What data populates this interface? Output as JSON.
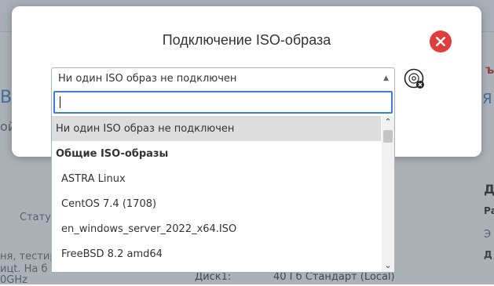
{
  "background": {
    "status_label": "Стату",
    "text_left_1": "ня, тестир",
    "text_left_2": "ицt. На б",
    "text_left_3": "0GHz",
    "text_left_4": "ой",
    "letter_b": "В",
    "letter_right_red": "ъ",
    "letter_right_blue": "Я",
    "right_d": "Д",
    "right_ra": "Ра",
    "right_e": "Э",
    "right_d2": "Д",
    "disk_label": "Диск1:",
    "disk_value": "40 Гб Стандарт (Local)"
  },
  "modal": {
    "title": "Подключение ISO-образа",
    "close_icon": "close-icon",
    "disc_icon": "disc-eject-icon"
  },
  "select": {
    "value": "Ни один ISO образ не подключен",
    "search_value": ""
  },
  "dropdown": {
    "options": [
      {
        "label": "Ни один ISO образ не подключен",
        "selected": true
      },
      {
        "label": "Общие ISO-образы",
        "group": true
      },
      {
        "label": "ASTRA Linux"
      },
      {
        "label": "CentOS 7.4 (1708)"
      },
      {
        "label": "en_windows_server_2022_x64.ISO"
      },
      {
        "label": "FreeBSD 8.2 amd64"
      }
    ]
  },
  "colors": {
    "accent": "#3a7fd0",
    "close": "#e23b3b",
    "selected_bg": "#dddddd"
  }
}
